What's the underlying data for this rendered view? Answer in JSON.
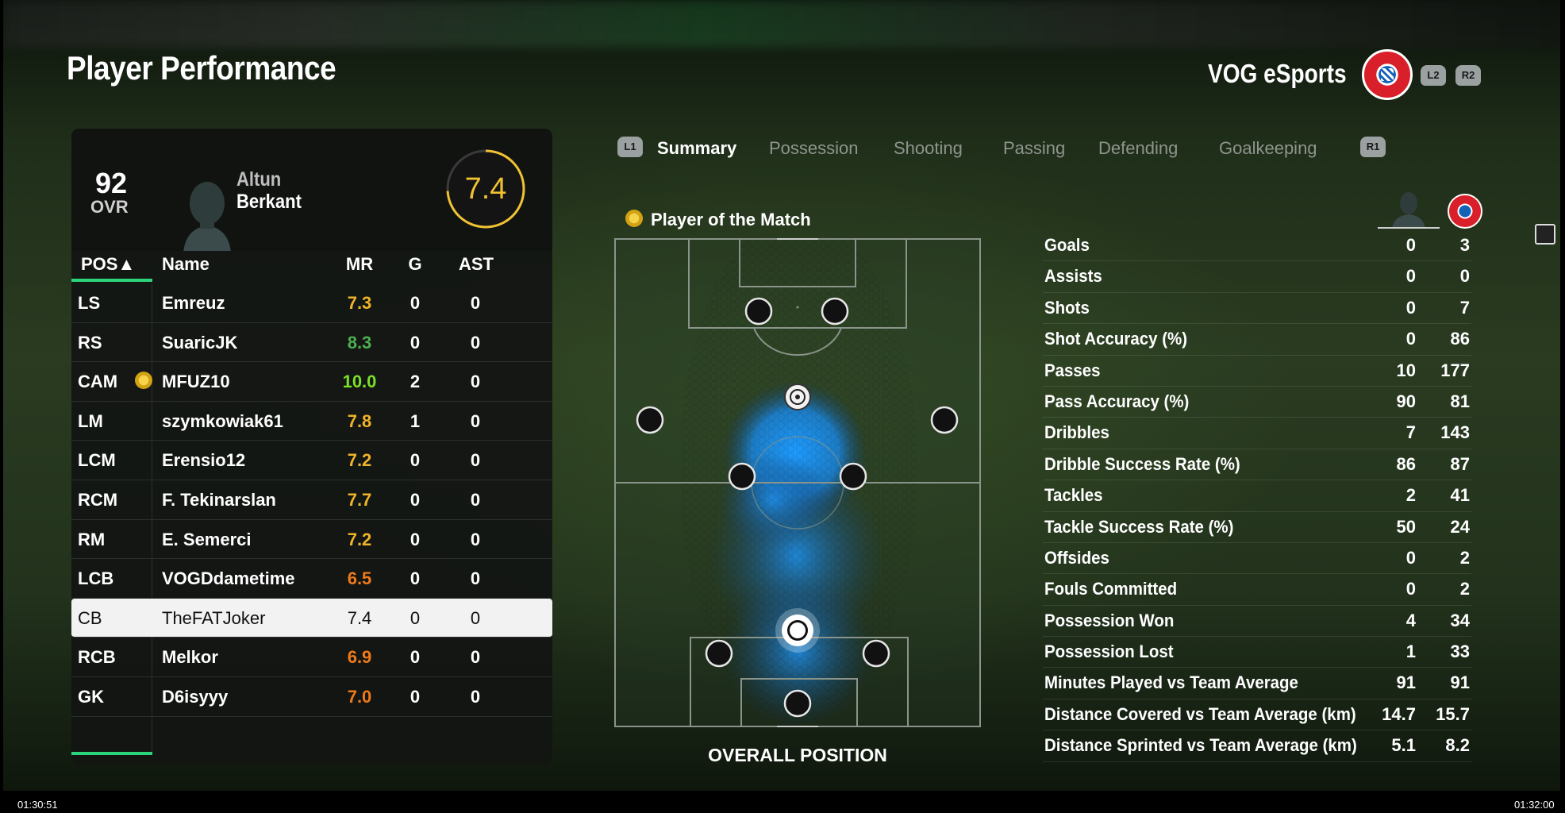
{
  "header": {
    "title": "Player Performance",
    "team_name": "VOG eSports",
    "btn_l2": "L2",
    "btn_r2": "R2"
  },
  "player_card": {
    "ovr_value": "92",
    "ovr_label": "OVR",
    "first_name": "Altun",
    "last_name": "Berkant",
    "match_rating": "7.4",
    "match_rating_fraction": 0.74
  },
  "table": {
    "headers": {
      "pos": "POS▲",
      "name": "Name",
      "mr": "MR",
      "g": "G",
      "ast": "AST"
    },
    "rows": [
      {
        "pos": "LS",
        "name": "Emreuz",
        "mr": "7.3",
        "g": "0",
        "ast": "0",
        "mr_color": "#f0b429"
      },
      {
        "pos": "RS",
        "name": "SuaricJK",
        "mr": "8.3",
        "g": "0",
        "ast": "0",
        "mr_color": "#4caf50"
      },
      {
        "pos": "CAM",
        "name": "MFUZ10",
        "mr": "10.0",
        "g": "2",
        "ast": "0",
        "mr_color": "#7be02a"
      },
      {
        "pos": "LM",
        "name": "szymkowiak61",
        "mr": "7.8",
        "g": "1",
        "ast": "0",
        "mr_color": "#f0b429"
      },
      {
        "pos": "LCM",
        "name": "Erensio12",
        "mr": "7.2",
        "g": "0",
        "ast": "0",
        "mr_color": "#f0b429"
      },
      {
        "pos": "RCM",
        "name": "F. Tekinarslan",
        "mr": "7.7",
        "g": "0",
        "ast": "0",
        "mr_color": "#f0b429"
      },
      {
        "pos": "RM",
        "name": "E. Semerci",
        "mr": "7.2",
        "g": "0",
        "ast": "0",
        "mr_color": "#f0b429"
      },
      {
        "pos": "LCB",
        "name": "VOGDdametime",
        "mr": "6.5",
        "g": "0",
        "ast": "0",
        "mr_color": "#f07a1a"
      },
      {
        "pos": "CB",
        "name": "TheFATJoker",
        "mr": "7.4",
        "g": "0",
        "ast": "0",
        "mr_color": "#111111"
      },
      {
        "pos": "RCB",
        "name": "Melkor",
        "mr": "6.9",
        "g": "0",
        "ast": "0",
        "mr_color": "#f07a1a"
      },
      {
        "pos": "GK",
        "name": "D6isyyy",
        "mr": "7.0",
        "g": "0",
        "ast": "0",
        "mr_color": "#f07a1a"
      }
    ]
  },
  "tabs": {
    "l1": "L1",
    "r1": "R1",
    "items": [
      "Summary",
      "Possession",
      "Shooting",
      "Passing",
      "Defending",
      "Goalkeeping"
    ],
    "active": "Summary"
  },
  "motm_label": "Player of the Match",
  "pitch_title": "OVERALL POSITION",
  "stats": [
    {
      "label": "Goals",
      "player": "0",
      "team": "3"
    },
    {
      "label": "Assists",
      "player": "0",
      "team": "0"
    },
    {
      "label": "Shots",
      "player": "0",
      "team": "7"
    },
    {
      "label": "Shot Accuracy (%)",
      "player": "0",
      "team": "86"
    },
    {
      "label": "Passes",
      "player": "10",
      "team": "177"
    },
    {
      "label": "Pass Accuracy (%)",
      "player": "90",
      "team": "81"
    },
    {
      "label": "Dribbles",
      "player": "7",
      "team": "143"
    },
    {
      "label": "Dribble Success Rate (%)",
      "player": "86",
      "team": "87"
    },
    {
      "label": "Tackles",
      "player": "2",
      "team": "41"
    },
    {
      "label": "Tackle Success Rate (%)",
      "player": "50",
      "team": "24"
    },
    {
      "label": "Offsides",
      "player": "0",
      "team": "2"
    },
    {
      "label": "Fouls Committed",
      "player": "0",
      "team": "2"
    },
    {
      "label": "Possession Won",
      "player": "4",
      "team": "34"
    },
    {
      "label": "Possession Lost",
      "player": "1",
      "team": "33"
    },
    {
      "label": "Minutes Played vs Team Average",
      "player": "91",
      "team": "91"
    },
    {
      "label": "Distance Covered vs Team Average (km)",
      "player": "14.7",
      "team": "15.7"
    },
    {
      "label": "Distance Sprinted vs Team Average (km)",
      "player": "5.1",
      "team": "8.2"
    }
  ],
  "timecodes": {
    "left": "01:30:51",
    "right": "01:32:00"
  },
  "colors": {
    "accent_green": "#2bd37b",
    "rating_gold": "#f0c232",
    "heatmap_blue": "#1e9bff"
  }
}
